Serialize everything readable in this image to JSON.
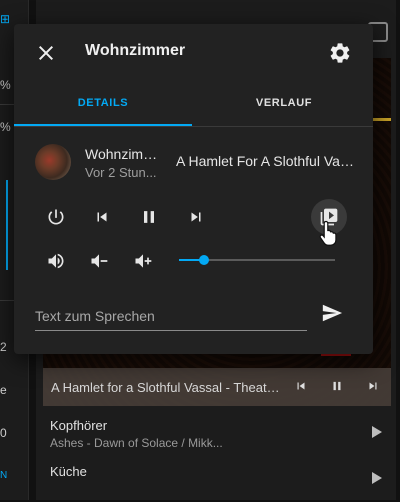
{
  "background": {
    "sidebar_texts": [
      "%",
      "%",
      "2",
      "e",
      "0",
      "N"
    ],
    "now_playing_title": "A Hamlet for a Slothful Vassal - Theatre ...",
    "list": [
      {
        "name": "Kopfhörer",
        "subtitle": "Ashes - Dawn of Solace / Mikk..."
      },
      {
        "name": "Küche",
        "subtitle": ""
      }
    ]
  },
  "dialog": {
    "title": "Wohnzimmer",
    "close_icon": "close-icon",
    "settings_icon": "gear-icon",
    "tabs": [
      {
        "label": "DETAILS",
        "active": true
      },
      {
        "label": "VERLAUF",
        "active": false
      }
    ],
    "entity": {
      "name": "Wohnzimm...",
      "last_changed": "Vor 2 Stun...",
      "state": "A Hamlet For A Slothful Vas..."
    },
    "controls": [
      "power-icon",
      "skip-previous-icon",
      "pause-icon",
      "skip-next-icon",
      "source-select-icon"
    ],
    "volume": {
      "buttons": [
        "volume-high-icon",
        "volume-minus-icon",
        "volume-plus-icon"
      ],
      "level": 0.16
    },
    "tts": {
      "placeholder": "Text zum Sprechen",
      "value": ""
    },
    "send_icon": "send-icon"
  },
  "colors": {
    "accent": "#03a9f4",
    "dialog_bg": "#222222",
    "page_bg": "#111111"
  }
}
